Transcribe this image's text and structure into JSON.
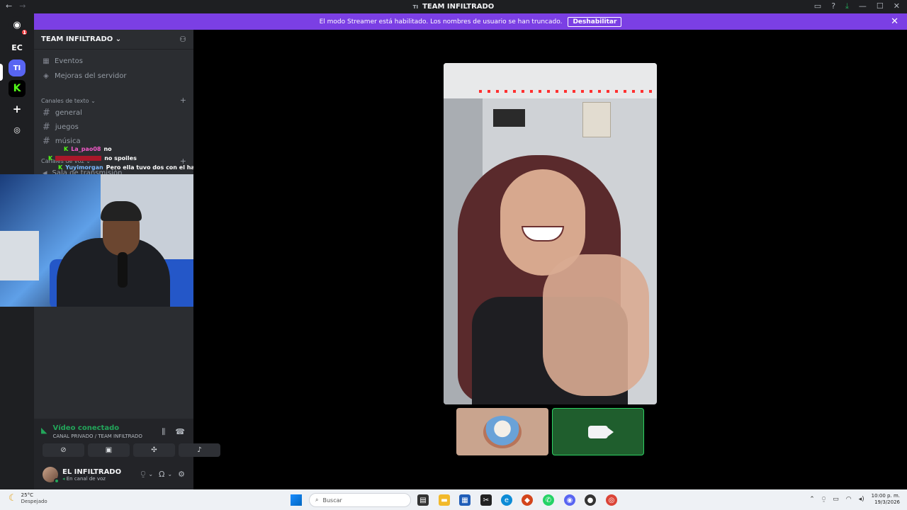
{
  "titlebar": {
    "server_abbr": "TI",
    "title": "TEAM INFILTRADO",
    "back": "←",
    "forward": "→"
  },
  "banner": {
    "text": "El modo Streamer está habilitado. Los nombres de usuario se han truncado.",
    "button": "Deshabilitar",
    "close": "✕"
  },
  "guilds": {
    "home_badge": "1",
    "ec": "EC",
    "ti": "TI"
  },
  "server": {
    "name": "TEAM INFILTRADO ⌄",
    "events": "Eventos",
    "boosts": "Mejoras del servidor",
    "text_category": "Canales de texto ⌄",
    "voice_category": "Canales de voz ⌄",
    "voice_channel": "Sala de transmisión"
  },
  "channels": [
    "general",
    "juegos",
    "música"
  ],
  "chat_overlay": [
    {
      "user": "La_pao08",
      "msg": "no"
    },
    {
      "user": "",
      "msg": "no spoiles"
    },
    {
      "user": "Yuyimorgan",
      "msg": "Pero ella tuvo dos con el haccoc."
    }
  ],
  "voice_panel": {
    "status": "Vídeo conectado",
    "channel": "CANAL PRIVADO / TEAM INFILTRADO"
  },
  "user": {
    "name": "EL INFILTRADO",
    "status": "En canal de voz"
  },
  "taskbar": {
    "temp": "25°C",
    "weather": "Despejado",
    "search_placeholder": "Buscar",
    "time": "10:00 p. m.",
    "date": "19/3/2026"
  },
  "colors": {
    "banner": "#7b3fe4",
    "connected": "#23a55a",
    "sidebar": "#2b2d31"
  }
}
